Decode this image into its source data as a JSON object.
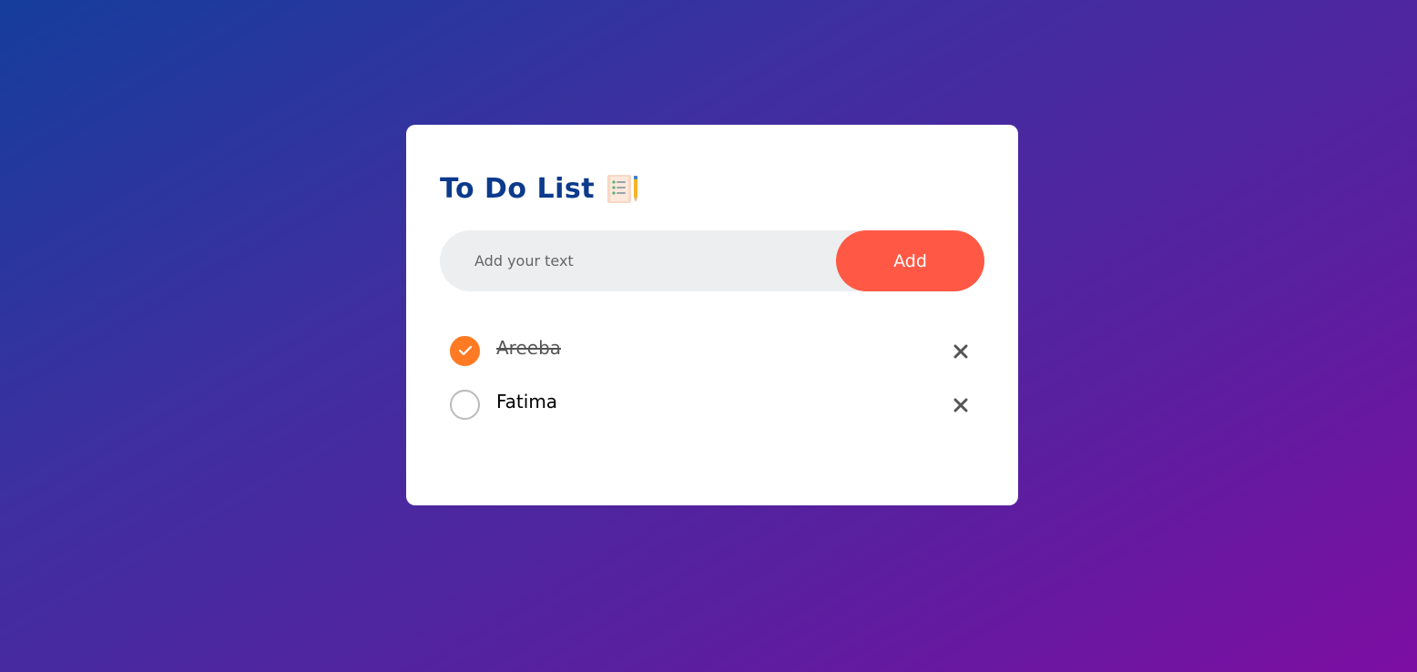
{
  "app": {
    "title": "To Do List",
    "title_icon": "clipboard-checklist-icon"
  },
  "input": {
    "placeholder": "Add your text",
    "value": "",
    "add_label": "Add"
  },
  "tasks": [
    {
      "label": "Areeba",
      "completed": true
    },
    {
      "label": "Fatima",
      "completed": false
    }
  ],
  "colors": {
    "title": "#0c3a8c",
    "add_button": "#ff5945",
    "checked": "#ff7a22",
    "input_bg": "#edeef0",
    "remove_icon": "#555555"
  }
}
